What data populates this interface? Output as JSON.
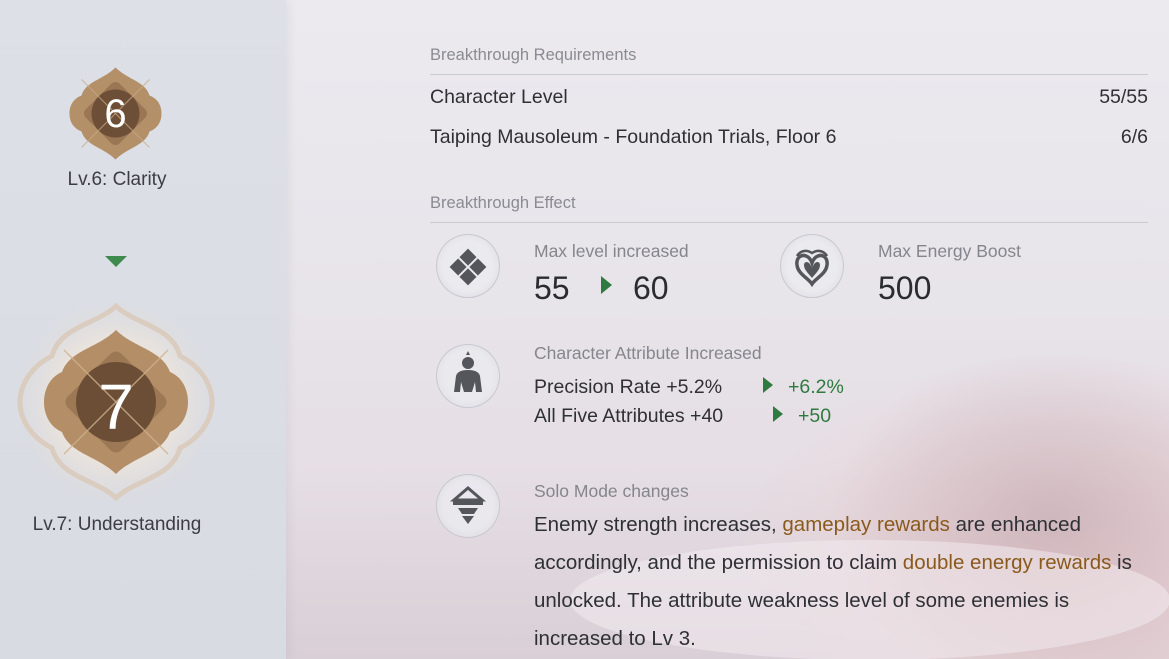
{
  "tiers": [
    {
      "number": "6",
      "label": "Lv.6: Clarity",
      "state": "current"
    },
    {
      "number": "7",
      "label": "Lv.7: Understanding",
      "state": "next"
    }
  ],
  "requirements": {
    "title": "Breakthrough Requirements",
    "items": [
      {
        "name": "Character Level",
        "value": "55/55"
      },
      {
        "name": "Taiping Mausoleum - Foundation Trials, Floor 6",
        "value": "6/6"
      }
    ]
  },
  "effects": {
    "title": "Breakthrough Effect",
    "max_level": {
      "label": "Max level increased",
      "from": "55",
      "to": "60",
      "icon": "diamond-icon"
    },
    "max_energy": {
      "label": "Max Energy Boost",
      "value": "500",
      "icon": "energy-emblem-icon"
    },
    "attributes": {
      "label": "Character Attribute Increased",
      "icon": "character-figure-icon",
      "rows": [
        {
          "name": "Precision Rate +5.2%",
          "new": "+6.2%"
        },
        {
          "name": "All Five Attributes +40",
          "new": "+50"
        }
      ]
    },
    "solo": {
      "label": "Solo Mode changes",
      "icon": "straw-hat-figure-icon",
      "desc_parts": [
        {
          "text": "Enemy strength increases, ",
          "highlight": false
        },
        {
          "text": "gameplay rewards",
          "highlight": true
        },
        {
          "text": " are enhanced accordingly, and the permission to claim ",
          "highlight": false
        },
        {
          "text": "double energy rewards",
          "highlight": true
        },
        {
          "text": " is unlocked. The attribute weakness level of some enemies is increased to Lv 3.",
          "highlight": false
        }
      ]
    }
  },
  "colors": {
    "badge_gold": "#b39068",
    "badge_dark": "#6e5238",
    "accent_green": "#2f7a3f",
    "highlight_brown": "#8a5a1c"
  }
}
